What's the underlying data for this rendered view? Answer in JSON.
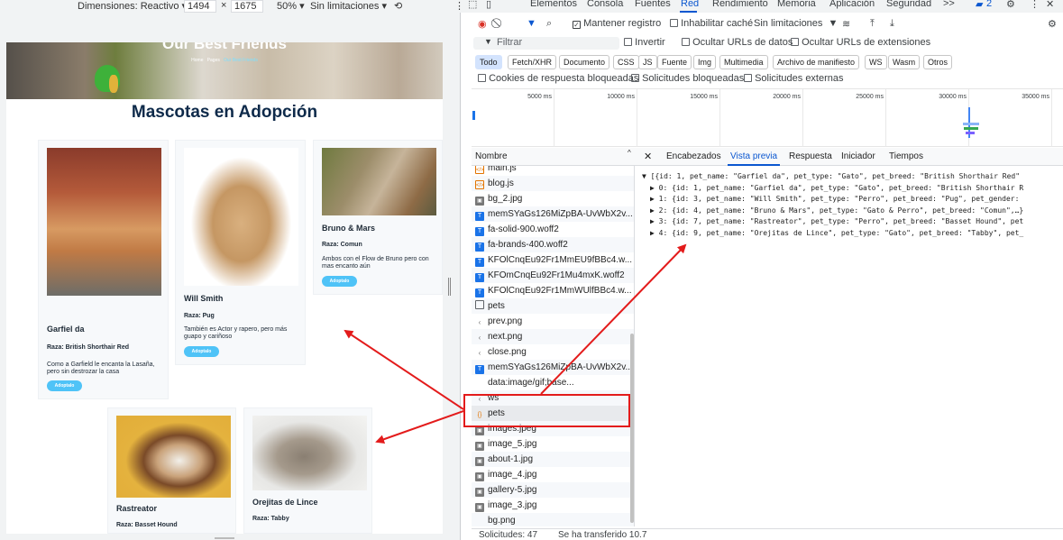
{
  "device_toolbar": {
    "dimensions_label": "Dimensiones: Reactivo",
    "width_value": "1494",
    "times": "×",
    "height_value": "1675",
    "zoom": "50%",
    "throttle": "Sin limitaciones",
    "more": "⋮"
  },
  "page": {
    "hero_title": "Our Best Friends",
    "breadcrumb": [
      "Home",
      "Pages",
      "Our Best Friends"
    ],
    "main_title": "Mascotas en Adopción",
    "adopt_label": "Adoptalo",
    "cards": [
      {
        "name": "Garfiel da",
        "breed": "Raza: British Shorthair Red",
        "desc": "Como a Garfield le encanta la Lasaña, pero sin destrozar la casa"
      },
      {
        "name": "Will Smith",
        "breed": "Raza: Pug",
        "desc": "También es Actor y rapero, pero más guapo y cariñoso"
      },
      {
        "name": "Bruno & Mars",
        "breed": "Raza: Comun",
        "desc": "Ambos con el Flow de Bruno pero con mas encanto aún"
      },
      {
        "name": "Rastreator",
        "breed": "Raza: Basset Hound",
        "desc": ""
      },
      {
        "name": "Orejitas de Lince",
        "breed": "Raza: Tabby",
        "desc": ""
      }
    ]
  },
  "devtools": {
    "tabs": [
      "Elementos",
      "Consola",
      "Fuentes",
      "Red",
      "Rendimiento",
      "Memoria",
      "Aplicación",
      "Seguridad",
      ">>"
    ],
    "active_tab": "Red",
    "badge_count": "2",
    "toolbar": {
      "keep_log": "Mantener registro",
      "disable_cache": "Inhabilitar caché",
      "throttle": "Sin limitaciones"
    },
    "filter": {
      "placeholder": "Filtrar",
      "invert": "Invertir",
      "hide_data_urls": "Ocultar URLs de datos",
      "hide_ext_urls": "Ocultar URLs de extensiones"
    },
    "type_filters": [
      "Todo",
      "Fetch/XHR",
      "Documento",
      "CSS",
      "JS",
      "Fuente",
      "Img",
      "Multimedia",
      "Archivo de manifiesto",
      "WS",
      "Wasm",
      "Otros"
    ],
    "active_type": "Todo",
    "blocked": {
      "blocked_cookies": "Cookies de respuesta bloqueadas",
      "blocked_requests": "Solicitudes bloqueadas",
      "third_party": "Solicitudes externas"
    },
    "timeline_ticks": [
      "5000 ms",
      "10000 ms",
      "15000 ms",
      "20000 ms",
      "25000 ms",
      "30000 ms",
      "35000 ms"
    ],
    "list_header": "Nombre",
    "requests": [
      {
        "name": "main.js",
        "icon": "js"
      },
      {
        "name": "blog.js",
        "icon": "js"
      },
      {
        "name": "bg_2.jpg",
        "icon": "img"
      },
      {
        "name": "memSYaGs126MiZpBA-UvWbX2v...",
        "icon": "font"
      },
      {
        "name": "fa-solid-900.woff2",
        "icon": "font"
      },
      {
        "name": "fa-brands-400.woff2",
        "icon": "font"
      },
      {
        "name": "KFOlCnqEu92Fr1MmEU9fBBc4.w...",
        "icon": "font"
      },
      {
        "name": "KFOmCnqEu92Fr1Mu4mxK.woff2",
        "icon": "font"
      },
      {
        "name": "KFOlCnqEu92Fr1MmWUlfBBc4.w...",
        "icon": "font"
      },
      {
        "name": "pets",
        "icon": "doc"
      },
      {
        "name": "prev.png",
        "icon": "txt"
      },
      {
        "name": "next.png",
        "icon": "txt"
      },
      {
        "name": "close.png",
        "icon": "txt"
      },
      {
        "name": "memSYaGs126MiZpBA-UvWbX2v...",
        "icon": "font"
      },
      {
        "name": "data:image/gif;base...",
        "icon": "none"
      },
      {
        "name": "ws",
        "icon": "txt"
      },
      {
        "name": "pets",
        "icon": "xhr"
      },
      {
        "name": "images.jpeg",
        "icon": "img"
      },
      {
        "name": "image_5.jpg",
        "icon": "img"
      },
      {
        "name": "about-1.jpg",
        "icon": "img"
      },
      {
        "name": "image_4.jpg",
        "icon": "img"
      },
      {
        "name": "gallery-5.jpg",
        "icon": "img"
      },
      {
        "name": "image_3.jpg",
        "icon": "img"
      },
      {
        "name": "bg.png",
        "icon": "none"
      }
    ],
    "detail_tabs": [
      "Encabezados",
      "Vista previa",
      "Respuesta",
      "Iniciador",
      "Tiempos"
    ],
    "active_detail_tab": "Vista previa",
    "preview_lines": [
      "▼ [{id: 1, pet_name: \"Garfiel da\", pet_type: \"Gato\", pet_breed: \"British Shorthair Red\"",
      "▶ 0: {id: 1, pet_name: \"Garfiel da\", pet_type: \"Gato\", pet_breed: \"British Shorthair R",
      "▶ 1: {id: 3, pet_name: \"Will Smith\", pet_type: \"Perro\", pet_breed: \"Pug\", pet_gender:",
      "▶ 2: {id: 4, pet_name: \"Bruno & Mars\", pet_type: \"Gato & Perro\", pet_breed: \"Comun\",…}",
      "▶ 3: {id: 7, pet_name: \"Rastreator\", pet_type: \"Perro\", pet_breed: \"Basset Hound\", pet",
      "▶ 4: {id: 9, pet_name: \"Orejitas de Lince\", pet_type: \"Gato\", pet_breed: \"Tabby\", pet_"
    ],
    "status": {
      "requests": "Solicitudes: 47",
      "transferred": "Se ha transferido 10.7"
    }
  },
  "colors": {
    "accent": "#0b57d0",
    "annotation": "#e31b1b",
    "adopt_button": "#4fc3f7",
    "title_navy": "#0e2a4a"
  }
}
